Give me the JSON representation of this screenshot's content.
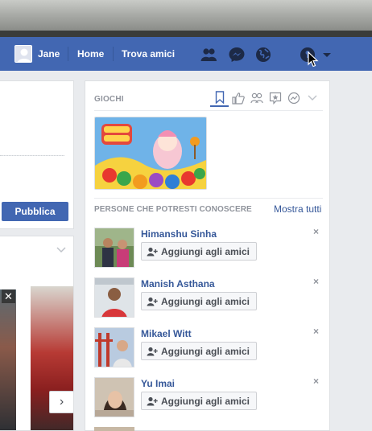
{
  "topbar": {
    "user_name": "Jane",
    "home_label": "Home",
    "find_friends_label": "Trova amici",
    "icons": [
      "friend-requests-icon",
      "messenger-icon",
      "notifications-globe-icon",
      "privacy-shortcuts-icon",
      "account-menu-chevron-icon"
    ],
    "bar_color": "#4267b2"
  },
  "left": {
    "publish_label": "Pubblica",
    "close_label": "✕",
    "next_label": "›"
  },
  "games": {
    "title": "GIOCHI",
    "tab_icons": [
      "bookmark-icon",
      "like-icon",
      "friends-icon",
      "star-speech-icon",
      "activity-icon",
      "chevron-down-icon"
    ],
    "thumbnail_name": "candy-crush-saga-thumbnail"
  },
  "pymk": {
    "title": "PERSONE CHE POTRESTI CONOSCERE",
    "see_all": "Mostra tutti",
    "add_label": "Aggiungi agli amici",
    "dismiss_label": "×",
    "people": [
      {
        "name": "Himanshu Sinha"
      },
      {
        "name": "Manish Asthana"
      },
      {
        "name": "Mikael Witt"
      },
      {
        "name": "Yu Imai"
      }
    ]
  },
  "colors": {
    "accent": "#4267b2",
    "link": "#365899",
    "muted": "#90949c"
  }
}
